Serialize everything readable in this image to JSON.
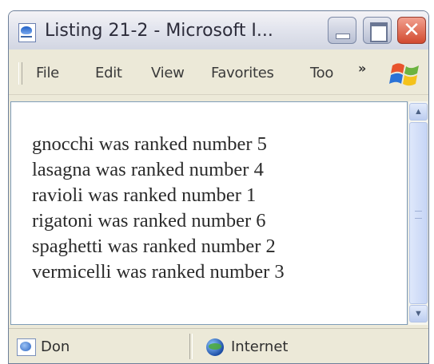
{
  "window": {
    "title": "Listing 21-2 - Microsoft I..."
  },
  "title_buttons": {
    "close_glyph": "✕"
  },
  "menu": {
    "items": [
      "File",
      "Edit",
      "View",
      "Favorites",
      "Too"
    ],
    "overflow": "»"
  },
  "content": {
    "lines": [
      "gnocchi was ranked number 5",
      "lasagna was ranked number 4",
      "ravioli was ranked number 1",
      "rigatoni was ranked number 6",
      "spaghetti was ranked number 2",
      "vermicelli was ranked number 3"
    ]
  },
  "scrollbar": {
    "up_glyph": "▲",
    "down_glyph": "▼"
  },
  "status": {
    "text": "Don",
    "zone": "Internet"
  },
  "icons": {
    "app": "ie-page-icon",
    "brand": "windows-logo-icon",
    "status": "page-done-icon",
    "zone": "internet-globe-icon"
  },
  "colors": {
    "title_gradient_top": "#f4f3f6",
    "chrome": "#ece9d8",
    "close_button": "#d24a2f",
    "scroll": "#c6d5f5"
  }
}
